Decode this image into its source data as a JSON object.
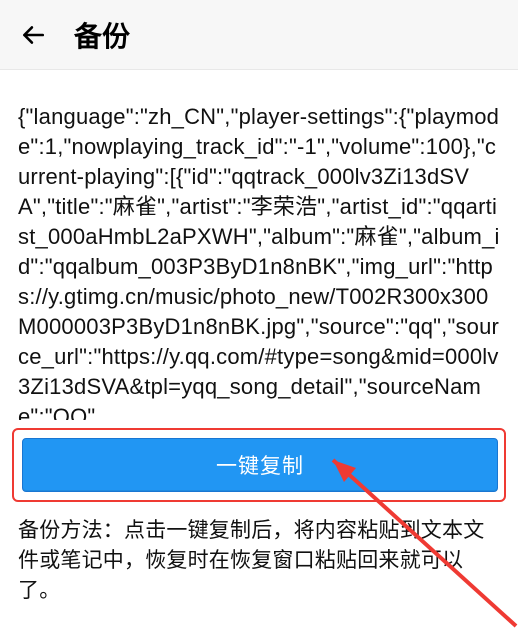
{
  "header": {
    "title": "备份"
  },
  "main": {
    "json_text": " {\"language\":\"zh_CN\",\"player-settings\":{\"playmode\":1,\"nowplaying_track_id\":\"-1\",\"volume\":100},\"current-playing\":[{\"id\":\"qqtrack_000lv3Zi13dSVA\",\"title\":\"麻雀\",\"artist\":\"李荣浩\",\"artist_id\":\"qqartist_000aHmbL2aPXWH\",\"album\":\"麻雀\",\"album_id\":\"qqalbum_003P3ByD1n8nBK\",\"img_url\":\"https://y.gtimg.cn/music/photo_new/T002R300x300M000003P3ByD1n8nBK.jpg\",\"source\":\"qq\",\"source_url\":\"https://y.qq.com/#type=song&mid=000lv3Zi13dSVA&tpl=yqq_song_detail\",\"sourceName\":\"QQ\""
  },
  "actions": {
    "copy_label": "一键复制"
  },
  "instructions": {
    "text": "备份方法：点击一键复制后，将内容粘贴到文本文件或笔记中，恢复时在恢复窗口粘贴回来就可以了。"
  },
  "icons": {
    "back": "arrow-left"
  },
  "colors": {
    "accent": "#2196f3",
    "highlight_border": "#ef3a33"
  }
}
